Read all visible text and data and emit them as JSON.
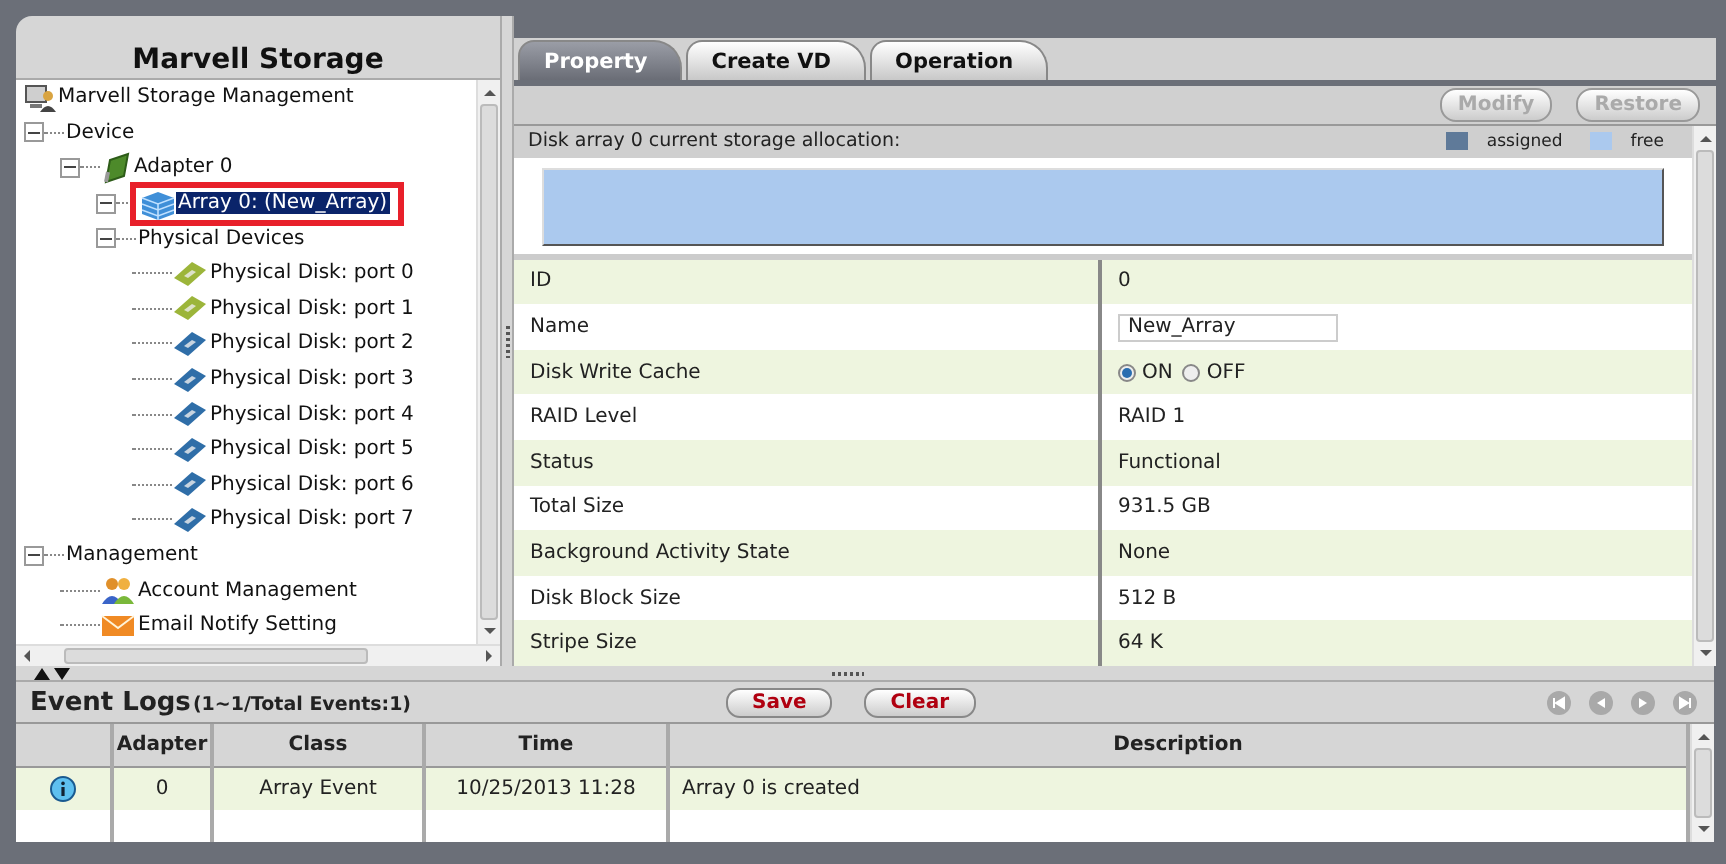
{
  "left_panel": {
    "title": "Marvell Storage",
    "tree": [
      {
        "label": "Marvell Storage Management",
        "kind": "system",
        "selected": false
      },
      {
        "label": "Device",
        "kind": "folder",
        "expanded": true,
        "selected": false,
        "children": [
          {
            "label": "Adapter 0",
            "kind": "adapter",
            "expanded": true,
            "selected": false,
            "children": [
              {
                "label": "Array 0: (New_Array)",
                "kind": "array",
                "expanded": true,
                "selected": true
              },
              {
                "label": "Physical Devices",
                "kind": "folder",
                "expanded": true,
                "selected": false,
                "children": [
                  {
                    "label": "Physical Disk: port 0",
                    "kind": "disk",
                    "color": "#9cb53a",
                    "selected": false
                  },
                  {
                    "label": "Physical Disk: port 1",
                    "kind": "disk",
                    "color": "#9cb53a",
                    "selected": false
                  },
                  {
                    "label": "Physical Disk: port 2",
                    "kind": "disk",
                    "color": "#2f6ea8",
                    "selected": false
                  },
                  {
                    "label": "Physical Disk: port 3",
                    "kind": "disk",
                    "color": "#2f6ea8",
                    "selected": false
                  },
                  {
                    "label": "Physical Disk: port 4",
                    "kind": "disk",
                    "color": "#2f6ea8",
                    "selected": false
                  },
                  {
                    "label": "Physical Disk: port 5",
                    "kind": "disk",
                    "color": "#2f6ea8",
                    "selected": false
                  },
                  {
                    "label": "Physical Disk: port 6",
                    "kind": "disk",
                    "color": "#2f6ea8",
                    "selected": false
                  },
                  {
                    "label": "Physical Disk: port 7",
                    "kind": "disk",
                    "color": "#2f6ea8",
                    "selected": false
                  }
                ]
              }
            ]
          }
        ]
      },
      {
        "label": "Management",
        "kind": "folder",
        "expanded": true,
        "selected": false,
        "children": [
          {
            "label": "Account Management",
            "kind": "account",
            "selected": false
          },
          {
            "label": "Email Notify Setting",
            "kind": "email",
            "selected": false
          }
        ]
      }
    ]
  },
  "right_panel": {
    "tabs": [
      {
        "label": "Property",
        "selected": true
      },
      {
        "label": "Create VD",
        "selected": false
      },
      {
        "label": "Operation",
        "selected": false
      }
    ],
    "toolbar_buttons": [
      {
        "label": "Modify",
        "disabled": true
      },
      {
        "label": "Restore",
        "disabled": true
      }
    ],
    "allocation": {
      "caption": "Disk array 0 current storage allocation:",
      "legend": [
        {
          "label": "assigned",
          "color": "#5f7a99"
        },
        {
          "label": "free",
          "color": "#abc9ee"
        }
      ]
    },
    "properties": [
      {
        "label": "ID",
        "kind": "text",
        "value": "0"
      },
      {
        "label": "Name",
        "kind": "input",
        "value": "New_Array"
      },
      {
        "label": "Disk Write Cache",
        "kind": "radio",
        "options": [
          {
            "label": "ON",
            "selected": true
          },
          {
            "label": "OFF",
            "selected": false
          }
        ]
      },
      {
        "label": "RAID Level",
        "kind": "text",
        "value": "RAID 1"
      },
      {
        "label": "Status",
        "kind": "text",
        "value": "Functional"
      },
      {
        "label": "Total Size",
        "kind": "text",
        "value": "931.5 GB"
      },
      {
        "label": "Background Activity State",
        "kind": "text",
        "value": "None"
      },
      {
        "label": "Disk Block Size",
        "kind": "text",
        "value": "512 B"
      },
      {
        "label": "Stripe Size",
        "kind": "text",
        "value": "64 K"
      }
    ]
  },
  "event_logs": {
    "title": "Event Logs",
    "summary": "(1~1/Total Events:1)",
    "buttons": [
      "Save",
      "Clear"
    ],
    "columns": [
      "Adapter",
      "Class",
      "Time",
      "Description"
    ],
    "rows": [
      {
        "kind": "info",
        "cells": [
          "0",
          "Array Event",
          "10/25/2013 11:28",
          "Array 0 is created"
        ]
      }
    ]
  }
}
